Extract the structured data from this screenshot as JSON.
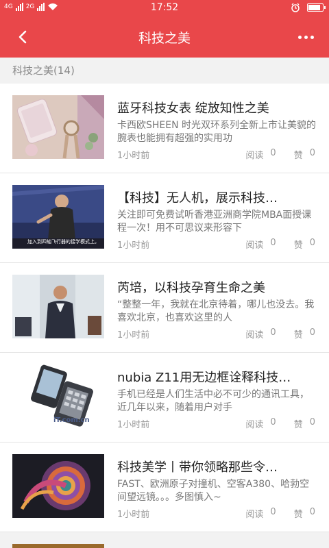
{
  "status_bar": {
    "network1": "4G",
    "network2": "2G",
    "time": "17:52",
    "battery_level": 0.9
  },
  "app_bar": {
    "title": "科技之美"
  },
  "section": {
    "header": "科技之美(14)"
  },
  "articles": [
    {
      "title": "蓝牙科技女表 绽放知性之美",
      "desc": "卡西欧SHEEN 时光双环系列全新上市让美貌的腕表也能拥有超强的实用功",
      "time": "1小时前",
      "read_label": "阅读",
      "read_count": "0",
      "like_label": "赞",
      "like_count": "0",
      "thumb_icon": "watch-phone-photo"
    },
    {
      "title": "【科技】无人机，展示科技…",
      "desc": "关注即可免费试听香港亚洲商学院MBA面授课程一次！用不可思议来形容下",
      "time": "1小时前",
      "read_label": "阅读",
      "read_count": "0",
      "like_label": "赞",
      "like_count": "0",
      "thumb_caption": "加入到四轴飞行器的接学模式上。",
      "thumb_icon": "speaker-stage-photo"
    },
    {
      "title": "芮培，以科技孕育生命之美",
      "desc": "“整整一年，我就在北京待着，哪儿也没去。我喜欢北京，也喜欢这里的人",
      "time": "1小时前",
      "read_label": "阅读",
      "read_count": "0",
      "like_label": "赞",
      "like_count": "0",
      "thumb_icon": "businessman-photo"
    },
    {
      "title": "nubia Z11用无边框诠释科技…",
      "desc": "手机已经是人们生活中必不可少的通讯工具，近几年以来，随着用户对手",
      "time": "1小时前",
      "read_label": "阅读",
      "read_count": "0",
      "like_label": "赞",
      "like_count": "0",
      "thumb_caption": "iT.com.cn",
      "thumb_icon": "flip-phone-photo"
    },
    {
      "title": "科技美学丨带你领略那些令…",
      "desc": "FAST、欧洲原子对撞机、空客A380、哈勃空间望远镜。。。多图慎入~",
      "time": "1小时前",
      "read_label": "阅读",
      "read_count": "0",
      "like_label": "赞",
      "like_count": "0",
      "thumb_icon": "spiral-art-photo"
    }
  ],
  "colors": {
    "primary": "#e9474a",
    "background": "#f2f2f2",
    "title_text": "#222222",
    "desc_text": "#777777",
    "meta_text": "#999999"
  }
}
